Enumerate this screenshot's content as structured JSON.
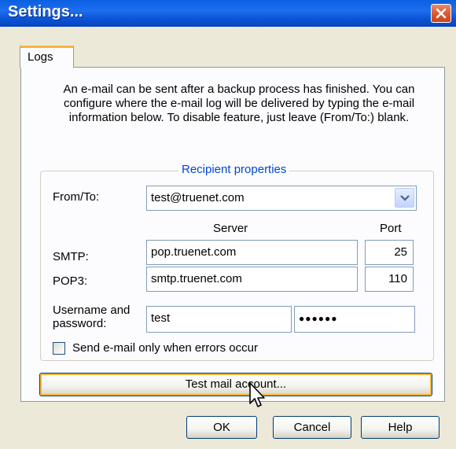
{
  "window": {
    "title": "Settings..."
  },
  "tabs": [
    {
      "label": "Logs"
    }
  ],
  "description": [
    "An e-mail can be sent after a backup process has finished. You can",
    "configure where the e-mail log will be delivered by typing the e-mail",
    "information below. To disable feature, just leave (From/To:) blank."
  ],
  "group": {
    "title": "Recipient properties",
    "from_to_label": "From/To:",
    "from_to_value": "test@truenet.com",
    "server_header": "Server",
    "port_header": "Port",
    "smtp_label": "SMTP:",
    "smtp_server": "pop.truenet.com",
    "smtp_port": "25",
    "pop3_label": "POP3:",
    "pop3_server": "smtp.truenet.com",
    "pop3_port": "110",
    "userpass_label_line1": "Username and",
    "userpass_label_line2": "password:",
    "username": "test",
    "password_mask": "●●●●●●",
    "checkbox_label": "Send e-mail only when errors occur",
    "checkbox_checked": false
  },
  "test_button": "Test mail account...",
  "footer": {
    "ok": "OK",
    "cancel": "Cancel",
    "help": "Help"
  },
  "colors": {
    "group_title": "#0046d5",
    "tab_highlight": "#f7b43a",
    "titlebar": "#0a5fe0"
  }
}
